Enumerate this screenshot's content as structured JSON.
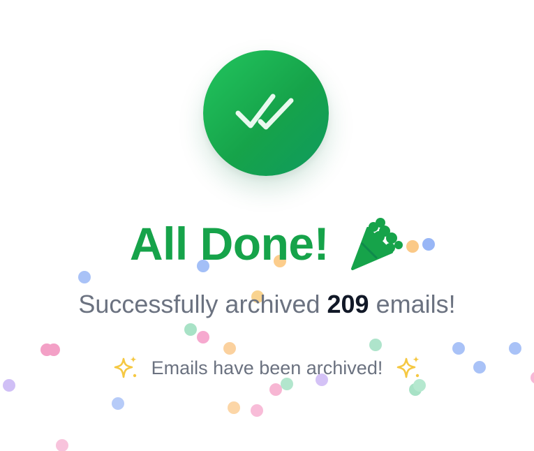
{
  "celebration": {
    "title": "All Done!",
    "subtitle_prefix": "Successfully archived ",
    "archived_count": "209",
    "subtitle_suffix": " emails!",
    "note": "Emails have been archived!"
  },
  "icons": {
    "status": "double-check-icon",
    "title_decoration": "party-popper-icon",
    "note_decoration": "sparkles-icon"
  },
  "colors": {
    "success": "#16a34a",
    "success_light": "#22c55e",
    "count_text": "#111827",
    "muted_text": "#6b7280",
    "sparkle": "#f5c842",
    "confetti": [
      "#93b4f8",
      "#fbc98a",
      "#a7e3c5",
      "#f7a8cf",
      "#c9b4f5"
    ]
  }
}
